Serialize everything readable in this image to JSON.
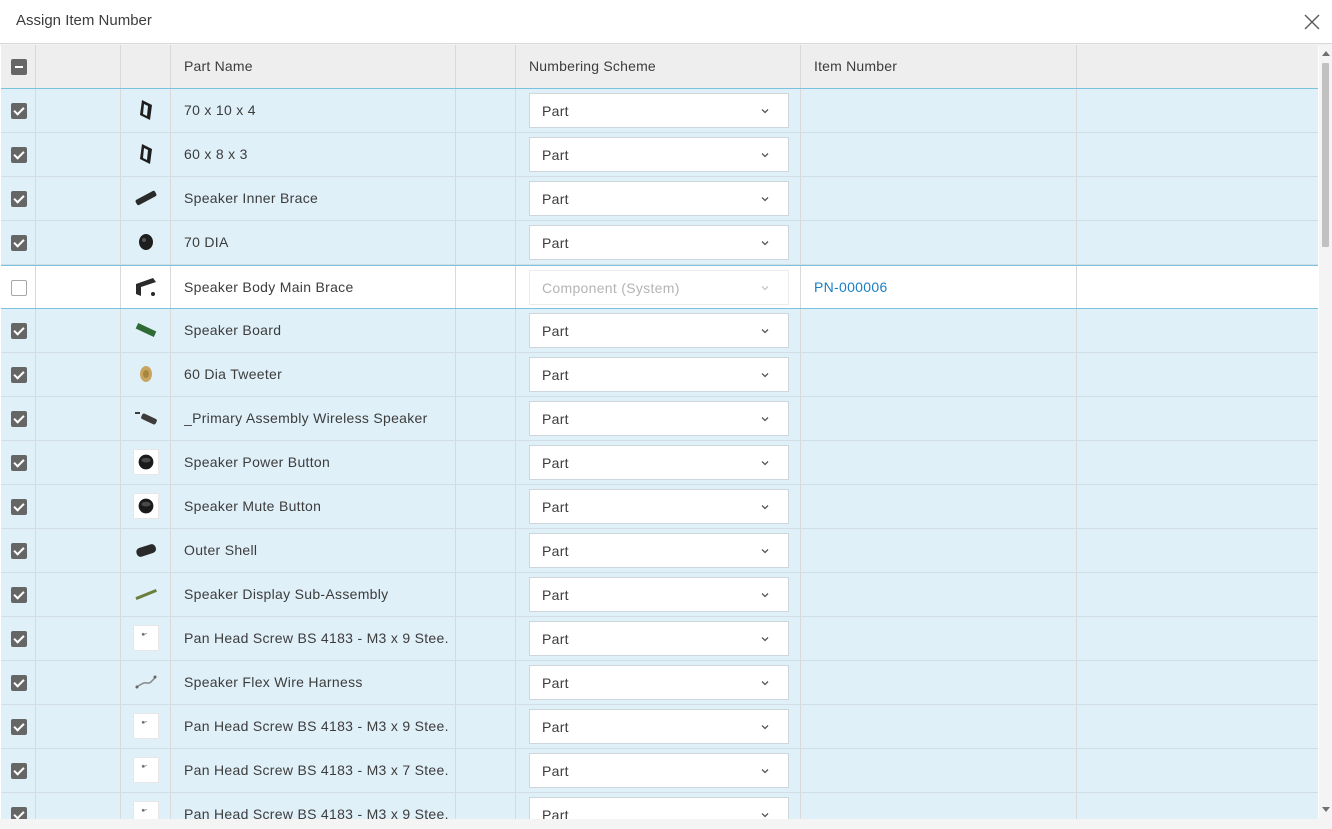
{
  "dialog": {
    "title": "Assign Item Number"
  },
  "columns": {
    "part_name": "Part Name",
    "numbering_scheme": "Numbering Scheme",
    "item_number": "Item Number"
  },
  "colors": {
    "selected_row": "#e0f0f9",
    "link": "#1b7fc4",
    "checkbox": "#666666"
  },
  "rows": [
    {
      "checked": true,
      "thumb": "frame-part-icon",
      "name": "70 x 10 x 4",
      "scheme": "Part",
      "item_number": ""
    },
    {
      "checked": true,
      "thumb": "frame-part-icon",
      "name": "60 x 8 x 3",
      "scheme": "Part",
      "item_number": ""
    },
    {
      "checked": true,
      "thumb": "brace-bar-icon",
      "name": "Speaker Inner Brace",
      "scheme": "Part",
      "item_number": ""
    },
    {
      "checked": true,
      "thumb": "cone-part-icon",
      "name": "70 DIA",
      "scheme": "Part",
      "item_number": ""
    },
    {
      "checked": false,
      "thumb": "bracket-part-icon",
      "name": "Speaker Body Main Brace",
      "scheme": "Component (System)",
      "item_number": "PN-000006",
      "disabled": true
    },
    {
      "checked": true,
      "thumb": "circuit-board-icon",
      "name": "Speaker Board",
      "scheme": "Part",
      "item_number": ""
    },
    {
      "checked": true,
      "thumb": "tweeter-icon",
      "name": "60 Dia Tweeter",
      "scheme": "Part",
      "item_number": ""
    },
    {
      "checked": true,
      "thumb": "speaker-assembly-icon",
      "name": "_Primary Assembly Wireless Speaker",
      "scheme": "Part",
      "item_number": ""
    },
    {
      "checked": true,
      "thumb": "round-button-icon",
      "name": "Speaker Power Button",
      "scheme": "Part",
      "item_number": ""
    },
    {
      "checked": true,
      "thumb": "round-button-icon",
      "name": "Speaker Mute Button",
      "scheme": "Part",
      "item_number": ""
    },
    {
      "checked": true,
      "thumb": "shell-part-icon",
      "name": "Outer Shell",
      "scheme": "Part",
      "item_number": ""
    },
    {
      "checked": true,
      "thumb": "display-board-icon",
      "name": "Speaker Display Sub-Assembly",
      "scheme": "Part",
      "item_number": ""
    },
    {
      "checked": true,
      "thumb": "screw-icon",
      "name": "Pan Head Screw BS 4183 - M3 x 9 Stee...",
      "scheme": "Part",
      "item_number": ""
    },
    {
      "checked": true,
      "thumb": "wire-harness-icon",
      "name": "Speaker Flex Wire Harness",
      "scheme": "Part",
      "item_number": ""
    },
    {
      "checked": true,
      "thumb": "screw-icon",
      "name": "Pan Head Screw BS 4183 - M3 x 9 Stee...",
      "scheme": "Part",
      "item_number": ""
    },
    {
      "checked": true,
      "thumb": "screw-icon",
      "name": "Pan Head Screw BS 4183 - M3 x 7 Stee...",
      "scheme": "Part",
      "item_number": ""
    },
    {
      "checked": true,
      "thumb": "screw-icon",
      "name": "Pan Head Screw BS 4183 - M3 x 9 Stee...",
      "scheme": "Part",
      "item_number": ""
    }
  ]
}
